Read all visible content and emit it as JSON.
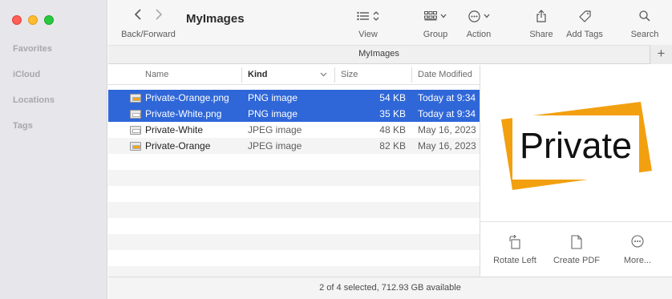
{
  "window": {
    "title": "MyImages",
    "tab_title": "MyImages"
  },
  "sidebar": {
    "sections": [
      {
        "label": "Favorites"
      },
      {
        "label": "iCloud"
      },
      {
        "label": "Locations"
      },
      {
        "label": "Tags"
      }
    ]
  },
  "toolbar": {
    "back_forward_label": "Back/Forward",
    "view_label": "View",
    "group_label": "Group",
    "action_label": "Action",
    "share_label": "Share",
    "add_tags_label": "Add Tags",
    "search_label": "Search"
  },
  "list": {
    "columns": [
      "Name",
      "Kind",
      "Size",
      "Date Modified"
    ],
    "sorted_column": "Kind",
    "rows": [
      {
        "name": "Private-Orange.png",
        "kind": "PNG image",
        "size": "54 KB",
        "date": "Today at 9:34",
        "selected": true,
        "icon_color": "#f2a51c"
      },
      {
        "name": "Private-White.png",
        "kind": "PNG image",
        "size": "35 KB",
        "date": "Today at 9:34",
        "selected": true,
        "icon_color": "#ffffff"
      },
      {
        "name": "Private-White",
        "kind": "JPEG image",
        "size": "48 KB",
        "date": "May 16, 2023",
        "selected": false,
        "icon_color": "#ffffff"
      },
      {
        "name": "Private-Orange",
        "kind": "JPEG image",
        "size": "82 KB",
        "date": "May 16, 2023",
        "selected": false,
        "icon_color": "#f2a51c"
      }
    ]
  },
  "preview": {
    "image_text": "Private",
    "accent_color": "#f2a00f",
    "actions": [
      {
        "label": "Rotate Left",
        "icon": "rotate-left-icon"
      },
      {
        "label": "Create PDF",
        "icon": "document-icon"
      },
      {
        "label": "More...",
        "icon": "ellipsis-icon"
      }
    ]
  },
  "status": {
    "text": "2 of 4 selected, 712.93 GB available"
  },
  "colors": {
    "selection": "#2f67d8",
    "sidebar_bg": "#e7e6ea"
  }
}
